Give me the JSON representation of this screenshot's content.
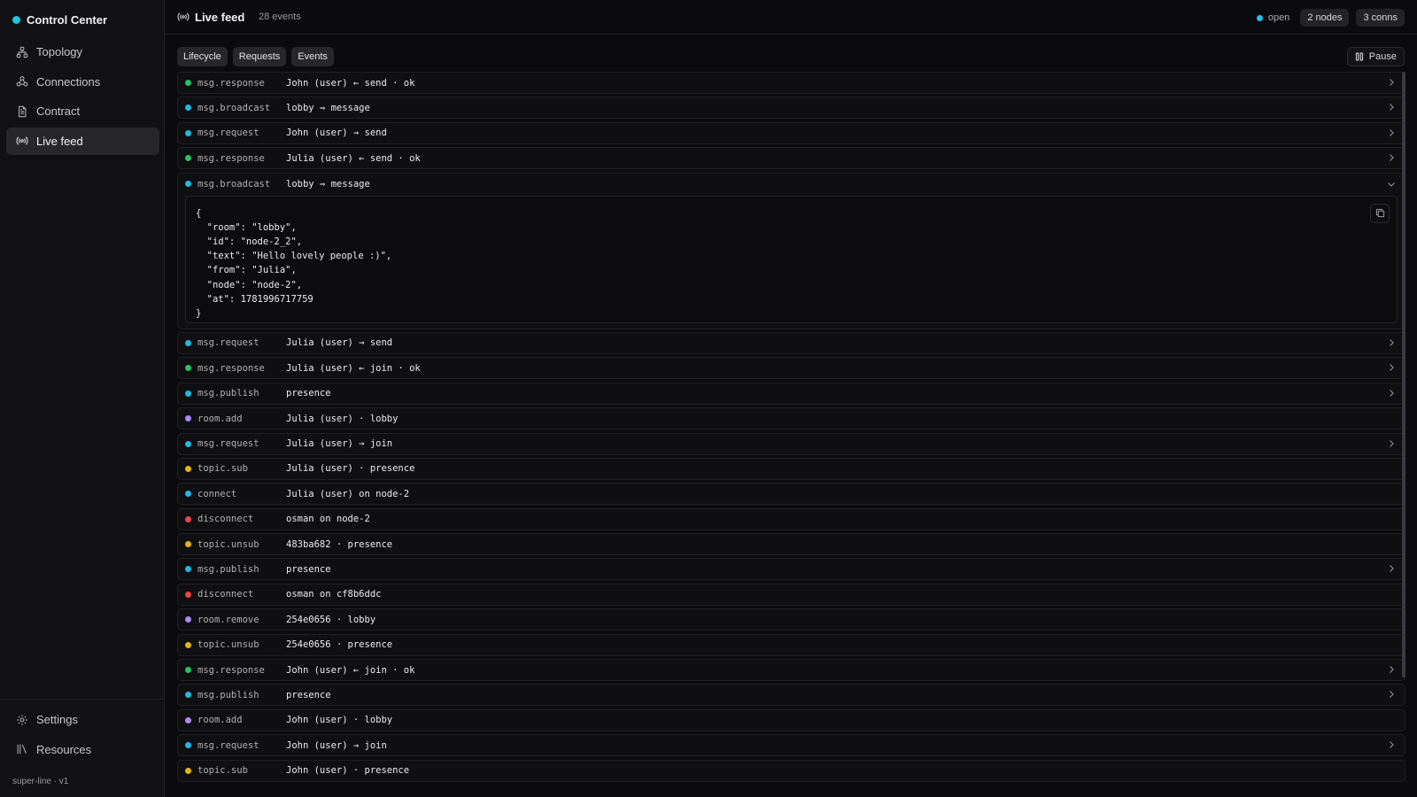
{
  "app": {
    "name": "Control Center",
    "version": "super-line · v1"
  },
  "sidebar": {
    "items": [
      {
        "label": "Topology",
        "icon": "topology-icon"
      },
      {
        "label": "Connections",
        "icon": "connections-icon"
      },
      {
        "label": "Contract",
        "icon": "document-icon"
      },
      {
        "label": "Live feed",
        "icon": "broadcast-icon",
        "active": true
      }
    ],
    "bottom": [
      {
        "label": "Settings",
        "icon": "gear-icon"
      },
      {
        "label": "Resources",
        "icon": "library-icon"
      }
    ]
  },
  "header": {
    "title": "Live feed",
    "count": "28 events",
    "status": "open",
    "nodes": "2 nodes",
    "conns": "3 conns"
  },
  "filters": [
    "Lifecycle",
    "Requests",
    "Events"
  ],
  "pause_label": "Pause",
  "colors": {
    "green": "#22c55e",
    "blue": "#22b8e6",
    "purple": "#a78bfa",
    "yellow": "#eab308",
    "red": "#ef4444"
  },
  "events": [
    {
      "type": "msg.response",
      "detail": "John (user) ← send · ok",
      "color": "green",
      "expandable": true
    },
    {
      "type": "msg.broadcast",
      "detail": "lobby ⇒ message",
      "color": "blue",
      "expandable": true
    },
    {
      "type": "msg.request",
      "detail": "John (user) → send",
      "color": "blue",
      "expandable": true
    },
    {
      "type": "msg.response",
      "detail": "Julia (user) ← send · ok",
      "color": "green",
      "expandable": true
    },
    {
      "type": "msg.broadcast",
      "detail": "lobby ⇒ message",
      "color": "blue",
      "expandable": true,
      "expanded": true,
      "payload": "{\n  \"room\": \"lobby\",\n  \"id\": \"node-2_2\",\n  \"text\": \"Hello lovely people :)\",\n  \"from\": \"Julia\",\n  \"node\": \"node-2\",\n  \"at\": 1781996717759\n}"
    },
    {
      "type": "msg.request",
      "detail": "Julia (user) → send",
      "color": "blue",
      "expandable": true
    },
    {
      "type": "msg.response",
      "detail": "Julia (user) ← join · ok",
      "color": "green",
      "expandable": true
    },
    {
      "type": "msg.publish",
      "detail": "presence",
      "color": "blue",
      "expandable": true
    },
    {
      "type": "room.add",
      "detail": "Julia (user) · lobby",
      "color": "purple",
      "expandable": false
    },
    {
      "type": "msg.request",
      "detail": "Julia (user) → join",
      "color": "blue",
      "expandable": true
    },
    {
      "type": "topic.sub",
      "detail": "Julia (user) · presence",
      "color": "yellow",
      "expandable": false
    },
    {
      "type": "connect",
      "detail": "Julia (user) on node-2",
      "color": "blue",
      "expandable": false
    },
    {
      "type": "disconnect",
      "detail": "osman on node-2",
      "color": "red",
      "expandable": false
    },
    {
      "type": "topic.unsub",
      "detail": "483ba682 · presence",
      "color": "yellow",
      "expandable": false
    },
    {
      "type": "msg.publish",
      "detail": "presence",
      "color": "blue",
      "expandable": true
    },
    {
      "type": "disconnect",
      "detail": "osman on cf8b6ddc",
      "color": "red",
      "expandable": false
    },
    {
      "type": "room.remove",
      "detail": "254e0656 · lobby",
      "color": "purple",
      "expandable": false
    },
    {
      "type": "topic.unsub",
      "detail": "254e0656 · presence",
      "color": "yellow",
      "expandable": false
    },
    {
      "type": "msg.response",
      "detail": "John (user) ← join · ok",
      "color": "green",
      "expandable": true
    },
    {
      "type": "msg.publish",
      "detail": "presence",
      "color": "blue",
      "expandable": true
    },
    {
      "type": "room.add",
      "detail": "John (user) · lobby",
      "color": "purple",
      "expandable": false
    },
    {
      "type": "msg.request",
      "detail": "John (user) → join",
      "color": "blue",
      "expandable": true
    },
    {
      "type": "topic.sub",
      "detail": "John (user) · presence",
      "color": "yellow",
      "expandable": false
    }
  ]
}
